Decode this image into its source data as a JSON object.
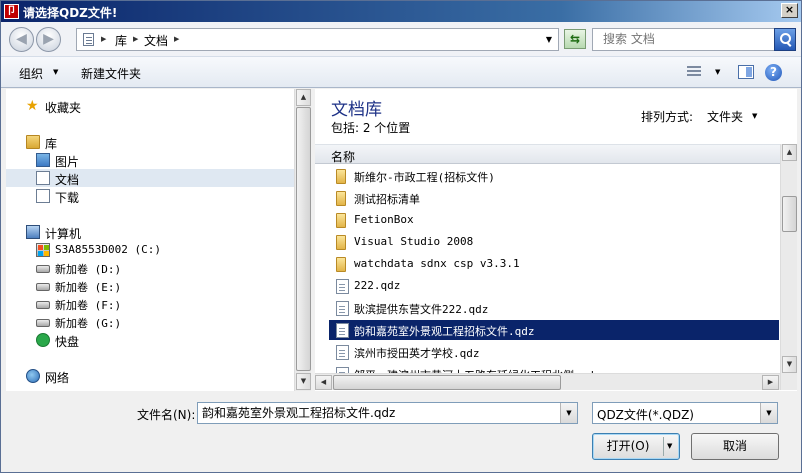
{
  "window": {
    "title": "请选择QDZ文件!",
    "close": "×"
  },
  "address": {
    "segments": [
      "库",
      "文档"
    ],
    "back_glyph": "◀",
    "fwd_glyph": "▶",
    "refresh_glyph": "⇆",
    "search_placeholder": "搜索 文档"
  },
  "toolbar": {
    "organize": "组织",
    "new_folder": "新建文件夹",
    "help": "?"
  },
  "nav": {
    "favorites": "收藏夹",
    "libraries": "库",
    "pictures": "图片",
    "documents": "文档",
    "downloads": "下载",
    "computer": "计算机",
    "drives": [
      {
        "label": "S3A8553D002 (C:)"
      },
      {
        "label": "新加卷 (D:)"
      },
      {
        "label": "新加卷 (E:)"
      },
      {
        "label": "新加卷 (F:)"
      },
      {
        "label": "新加卷 (G:)"
      }
    ],
    "kuaipan": "快盘",
    "network": "网络"
  },
  "content": {
    "library_title": "文档库",
    "library_sub": "包括: 2 个位置",
    "arrange_label": "排列方式:",
    "arrange_value": "文件夹",
    "column_name": "名称",
    "files": [
      {
        "name": "斯维尔-市政工程(招标文件)",
        "kind": "folder"
      },
      {
        "name": "测试招标清单",
        "kind": "folder"
      },
      {
        "name": "FetionBox",
        "kind": "folder"
      },
      {
        "name": "Visual Studio 2008",
        "kind": "folder"
      },
      {
        "name": "watchdata sdnx csp v3.3.1",
        "kind": "folder"
      },
      {
        "name": "222.qdz",
        "kind": "qdz"
      },
      {
        "name": "耿滨提供东营文件222.qdz",
        "kind": "qdz"
      },
      {
        "name": "韵和嘉苑室外景观工程招标文件.qdz",
        "kind": "qdz",
        "selected": true
      },
      {
        "name": "滨州市授田英才学校.qdz",
        "kind": "qdz"
      },
      {
        "name": "邹平一建滨州市黄河十五路东延绿化工程北侧.qdz",
        "kind": "qdz"
      }
    ]
  },
  "bottom": {
    "filename_label": "文件名(N):",
    "filename_value": "韵和嘉苑室外景观工程招标文件.qdz",
    "filetype_value": "QDZ文件(*.QDZ)",
    "open_label": "打开(O)",
    "cancel_label": "取消"
  }
}
